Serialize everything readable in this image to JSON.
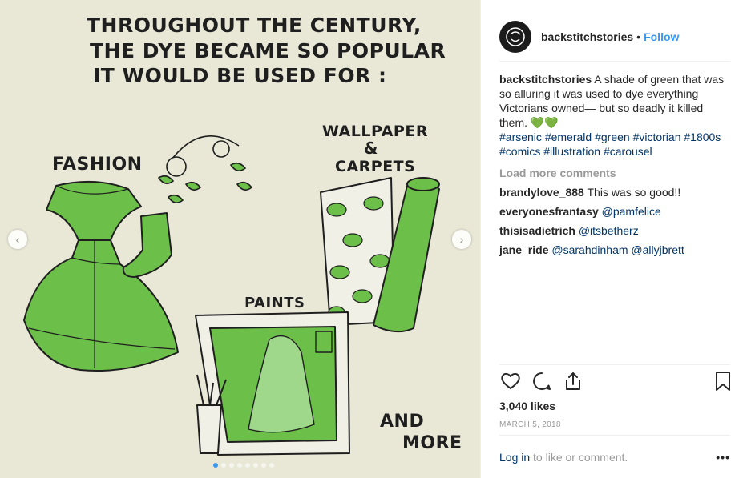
{
  "post": {
    "title_lines": [
      "THROUGHOUT THE CENTURY,",
      "THE DYE BECAME SO POPULAR",
      "IT WOULD BE USED FOR :"
    ],
    "labels": {
      "fashion": "FASHION",
      "wallpaper": "WALLPAPER",
      "amp": "&",
      "carpets": "CARPETS",
      "paints": "PAINTS",
      "and": "AND",
      "more": "MORE"
    },
    "slide_count": 8,
    "active_slide": 1
  },
  "header": {
    "username": "backstitchstories",
    "separator": "•",
    "follow_label": "Follow"
  },
  "caption": {
    "username": "backstitchstories",
    "text": "A shade of green that was so alluring it was used to dye everything Victorians owned— but so deadly it killed them.",
    "emoji": "💚💚",
    "hashtags": [
      "#arsenic",
      "#emerald",
      "#green",
      "#victorian",
      "#1800s",
      "#comics",
      "#illustration",
      "#carousel"
    ]
  },
  "load_more": "Load more comments",
  "comments": [
    {
      "user": "brandylove_888",
      "text": "This was so good!!",
      "mentions": []
    },
    {
      "user": "everyonesfrantasy",
      "text": "",
      "mentions": [
        "@pamfelice"
      ]
    },
    {
      "user": "thisisadietrich",
      "text": "",
      "mentions": [
        "@itsbetherz"
      ]
    },
    {
      "user": "jane_ride",
      "text": "",
      "mentions": [
        "@sarahdinham",
        "@allyjbrett"
      ]
    }
  ],
  "stats": {
    "likes": "3,040 likes",
    "date": "MARCH 5, 2018"
  },
  "footer": {
    "login": "Log in",
    "text": " to like or comment.",
    "more": "•••"
  },
  "colors": {
    "accent": "#3897f0",
    "link": "#003569",
    "illustration_bg": "#e9e8d7",
    "dye_green": "#5cb85c"
  },
  "icons": [
    "chevron-left-icon",
    "chevron-right-icon",
    "heart-icon",
    "comment-icon",
    "share-icon",
    "bookmark-icon",
    "more-icon"
  ]
}
